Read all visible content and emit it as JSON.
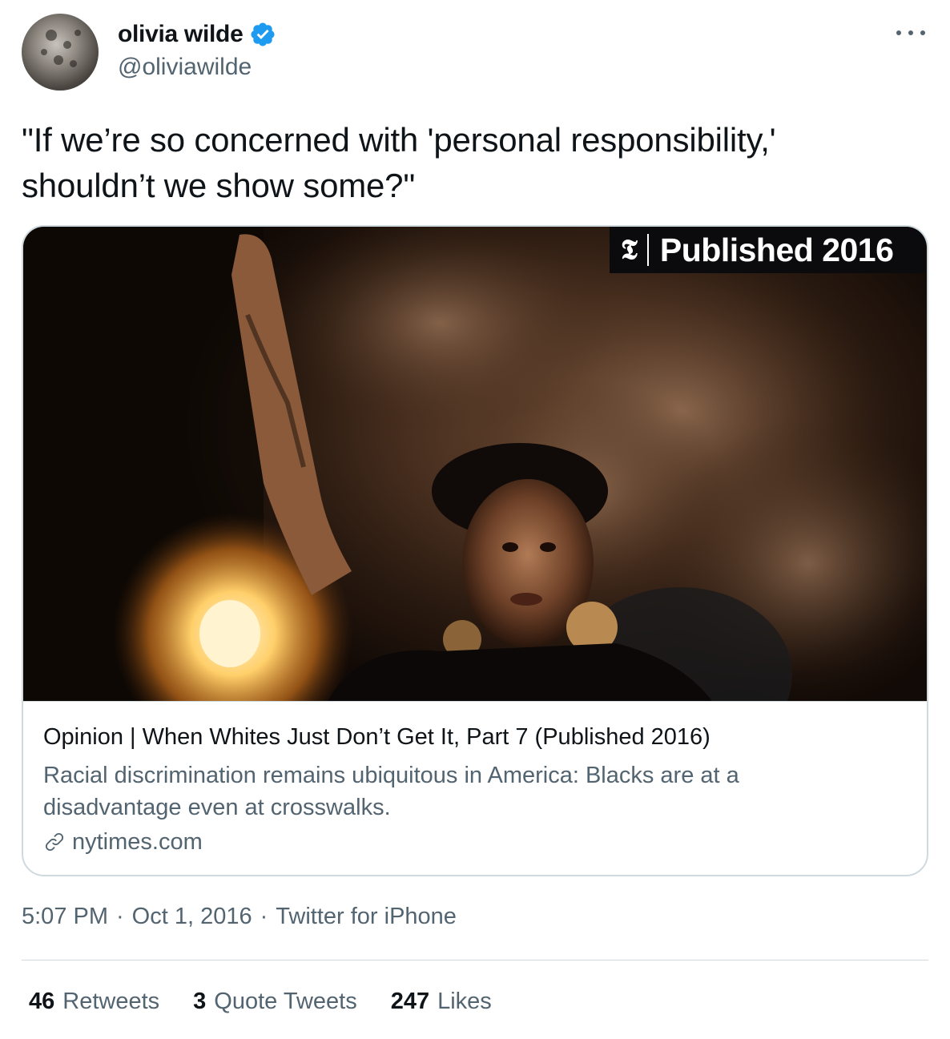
{
  "tweet": {
    "author_name": "olivia wilde",
    "handle": "@oliviawilde",
    "text_line1": "\"If we’re so concerned with 'personal responsibility,'",
    "text_line2": "shouldn’t we show some?\"",
    "icons": {
      "verified": "verified-badge-icon",
      "more": "more-options-icon",
      "link": "link-icon"
    },
    "colors": {
      "verified": "#1d9bf0",
      "secondary_text": "#536471",
      "border": "#cfd9de"
    }
  },
  "card": {
    "badge_logo": "𝕿",
    "badge_text": "Published 2016",
    "title": "Opinion | When Whites Just Don’t Get It, Part 7 (Published 2016)",
    "description_line1": "Racial discrimination remains ubiquitous in America: Blacks are at a",
    "description_line2": "disadvantage even at crosswalks.",
    "domain": "nytimes.com"
  },
  "meta": {
    "time": "5:07 PM",
    "date": "Oct 1, 2016",
    "source": "Twitter for iPhone"
  },
  "stats": {
    "retweets_count": "46",
    "retweets_label": "Retweets",
    "quotes_count": "3",
    "quotes_label": "Quote Tweets",
    "likes_count": "247",
    "likes_label": "Likes"
  }
}
